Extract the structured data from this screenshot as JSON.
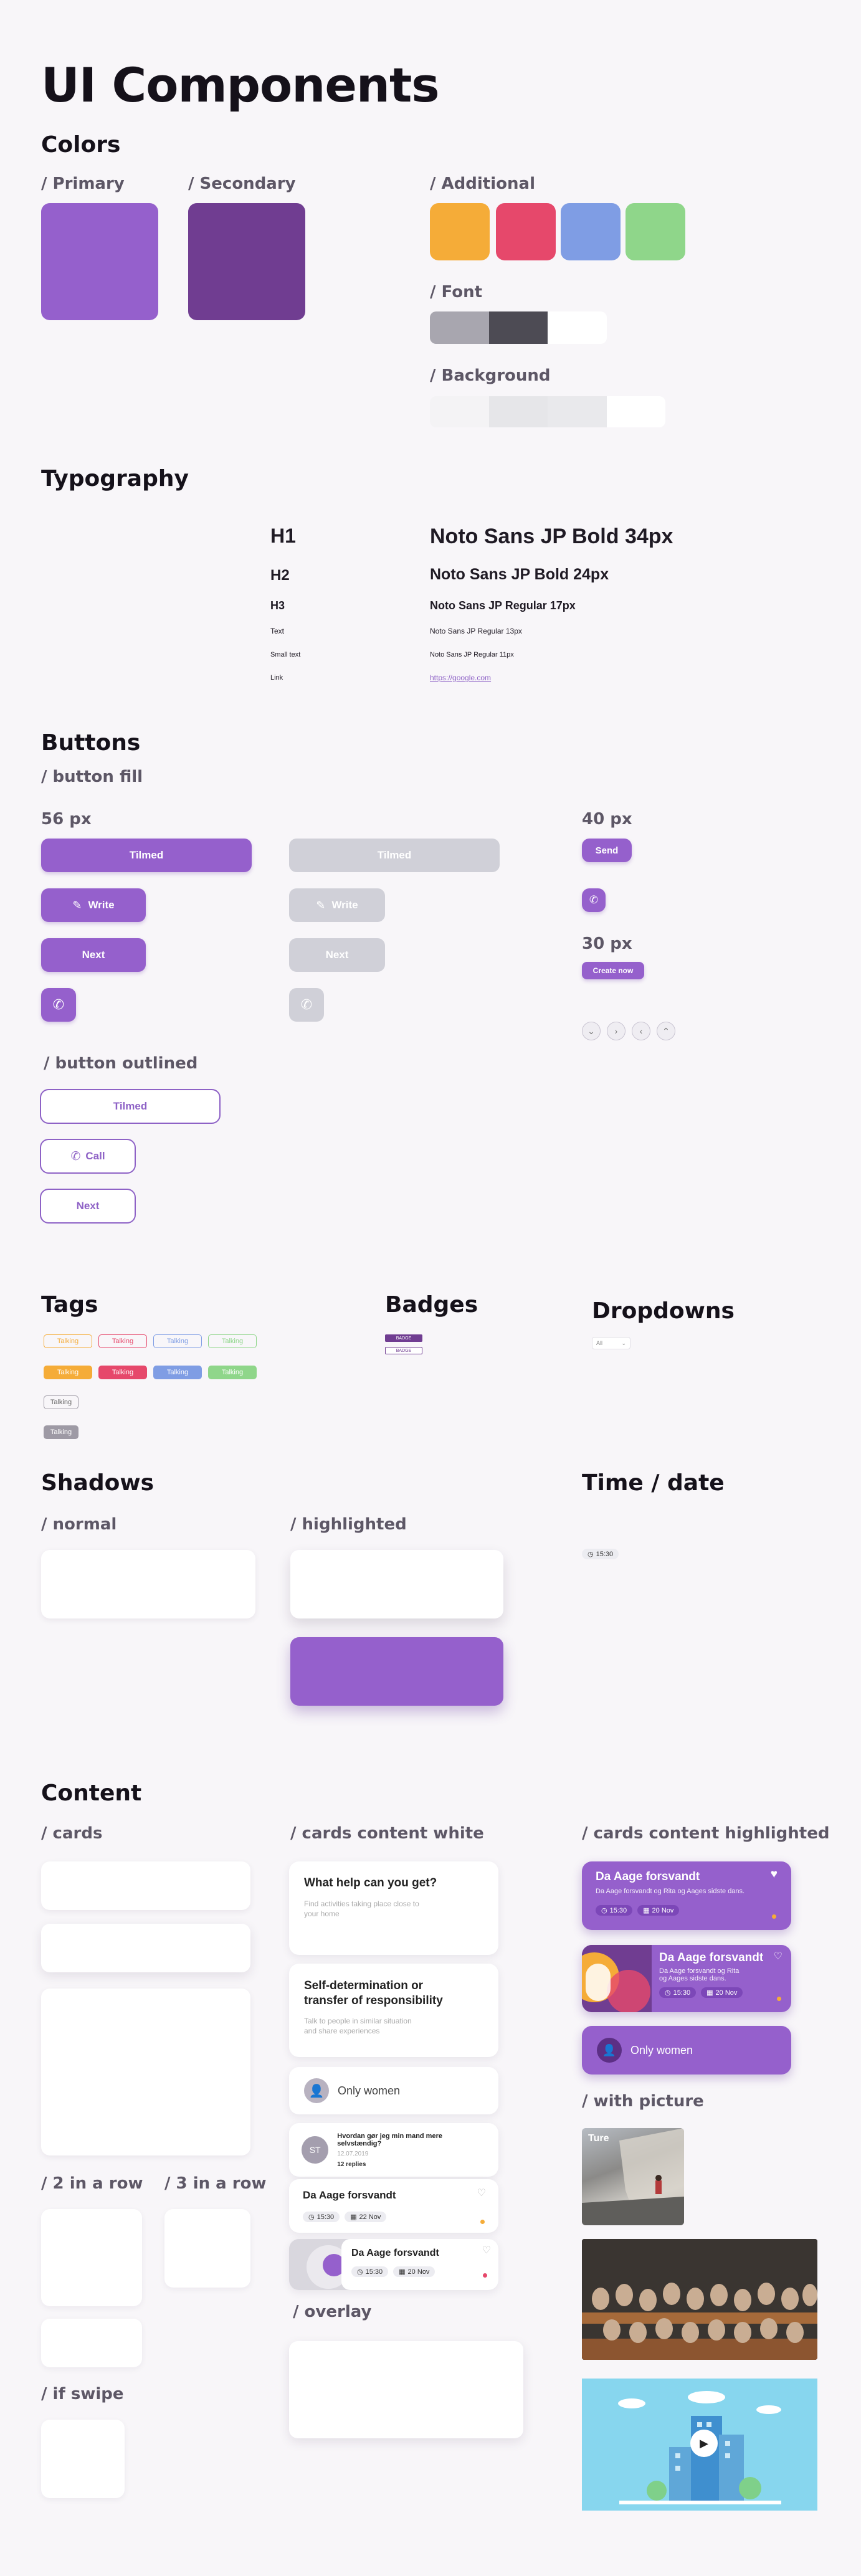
{
  "title": "UI Components",
  "colors": {
    "heading": "Colors",
    "primary": "/ Primary",
    "secondary": "/ Secondary",
    "additional": "/ Additional",
    "font": "/ Font",
    "background": "/ Background",
    "primary_hex": "#9560cc",
    "secondary_hex": "#703d91",
    "additional_hex": [
      "#f5ac38",
      "#e6486b",
      "#7f9de4",
      "#8fd68a"
    ],
    "font_hex": [
      "#a8a6af",
      "#4d4b54",
      "#ffffff"
    ],
    "background_hex": [
      "#f4f3f5",
      "#e6e6e9",
      "#e9e9ec",
      "#ffffff"
    ]
  },
  "typography": {
    "heading": "Typography",
    "rows": [
      {
        "label": "H1",
        "sample": "Noto Sans JP Bold 34px"
      },
      {
        "label": "H2",
        "sample": "Noto Sans JP Bold 24px"
      },
      {
        "label": "H3",
        "sample": "Noto Sans JP Regular 17px"
      },
      {
        "label": "Text",
        "sample": "Noto Sans JP Regular 13px"
      },
      {
        "label": "Small text",
        "sample": "Noto Sans JP Regular 11px"
      },
      {
        "label": "Link",
        "sample": "https://google.com"
      }
    ]
  },
  "buttons": {
    "heading": "Buttons",
    "fill": "/ button fill",
    "size56": "56 px",
    "size40": "40 px",
    "size30": "30 px",
    "tilmed": "Tilmed",
    "write": "Write",
    "next": "Next",
    "send": "Send",
    "create_now": "Create now",
    "outlined": "/ button outlined",
    "call": "Call"
  },
  "tags": {
    "heading": "Tags",
    "label": "Talking"
  },
  "badges": {
    "heading": "Badges",
    "b1": "BADGE",
    "b2": "BADGE"
  },
  "dropdowns": {
    "heading": "Dropdowns",
    "value": "All"
  },
  "shadows": {
    "heading": "Shadows",
    "normal": "/ normal",
    "highlighted": "/ highlighted"
  },
  "timedate": {
    "heading": "Time / date",
    "time": "15:30"
  },
  "content": {
    "heading": "Content",
    "cards": "/ cards",
    "white": "/ cards content white",
    "highlighted": "/ cards content highlighted",
    "two": "/ 2 in a row",
    "three": "/ 3 in a row",
    "swipe": "/ if swipe",
    "overlay": "/ overlay",
    "picture": "/ with picture",
    "help_title": "What help can you get?",
    "help_text": "Find activities taking place close to your home",
    "self_title": "Self-determination or transfer of responsibility",
    "self_text": "Talk to people in similar situation and share experiences",
    "only_women": "Only women",
    "initials": "ST",
    "msg_title": "Hvordan gør jeg min mand mere selvstændig?",
    "msg_date": "12.07.2019",
    "msg_replies": "12 replies",
    "event_title": "Da Aage forsvandt",
    "event_desc": "Da Aage forsvandt og Rita og Aages sidste dans.",
    "time": "15:30",
    "date": "20 Nov",
    "date2": "22 Nov",
    "pic_label": "Ture"
  }
}
